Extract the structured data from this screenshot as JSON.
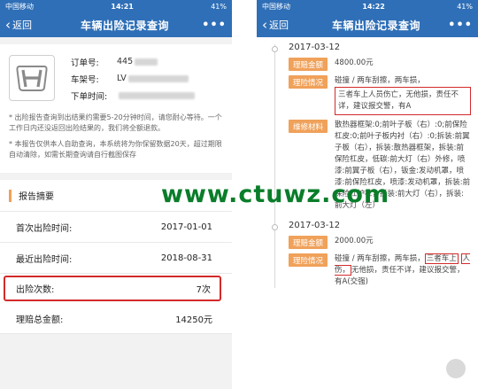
{
  "left": {
    "status": {
      "carrier": "中国移动",
      "time": "14:21",
      "battery": "41%"
    },
    "nav": {
      "back_label": "返回",
      "title": "车辆出险记录查询",
      "more": "•••"
    },
    "vehicle": {
      "order_label": "订单号:",
      "order_value": "445",
      "vin_label": "车架号:",
      "vin_value": "LV",
      "time_label": "下单时间:"
    },
    "notes": [
      "* 出险报告查询到出结果约需要5-20分钟时间，请您耐心等待。一个工作日内还没返回出险结果的，我们将全额退款。",
      "* 本报告仅供本人自助查询，本系统将为你保留数据20天，超过期限自动清除，如需长期查询请自行截图保存"
    ],
    "summary": {
      "title": "报告摘要",
      "rows": [
        {
          "label": "首次出险时间:",
          "value": "2017-01-01"
        },
        {
          "label": "最近出险时间:",
          "value": "2018-08-31"
        },
        {
          "label": "出险次数:",
          "value": "7次"
        },
        {
          "label": "理赔总金额:",
          "value": "14250元"
        }
      ]
    }
  },
  "right": {
    "status": {
      "carrier": "中国移动",
      "time": "14:22",
      "battery": "41%"
    },
    "nav": {
      "back_label": "返回",
      "title": "车辆出险记录查询",
      "more": "•••"
    },
    "entries": [
      {
        "date": "2017-03-12",
        "amount_tag": "理赔金额",
        "amount": "4800.00元",
        "case_tag": "理险情况",
        "case_plain": "碰撞 / 两车刮擦，两车损，",
        "case_boxed": "三者车上人员伤亡，无他损，责任不详，建议报交警，有A",
        "repair_tag": "维修材料",
        "repair": "散热器框架:0;前叶子板（右）:0;前保险杠皮:0;前叶子板内衬（右）:0;拆装:前翼子板（右），拆装:散热器框架，拆装:前保险杠皮，低碳:前大灯（右）外修，喷漆:前翼子板（右），钣金:发动机罩，喷漆:前保险杠皮，喷漆:发动机罩，拆装:前保险杠护杠，拆装:前大灯（右），拆装:前大灯（左）"
      },
      {
        "date": "2017-03-12",
        "amount_tag": "理赔金额",
        "amount": "2000.00元",
        "case_tag": "理险情况",
        "case_a": "碰撞 / 两车刮擦，两车损，",
        "case_b": "三者车上",
        "case_c": "人伤，",
        "case_d": "无他损，责任不详，建议报交警，有A(交强)"
      }
    ]
  },
  "watermark": "www.ctuwz.com"
}
